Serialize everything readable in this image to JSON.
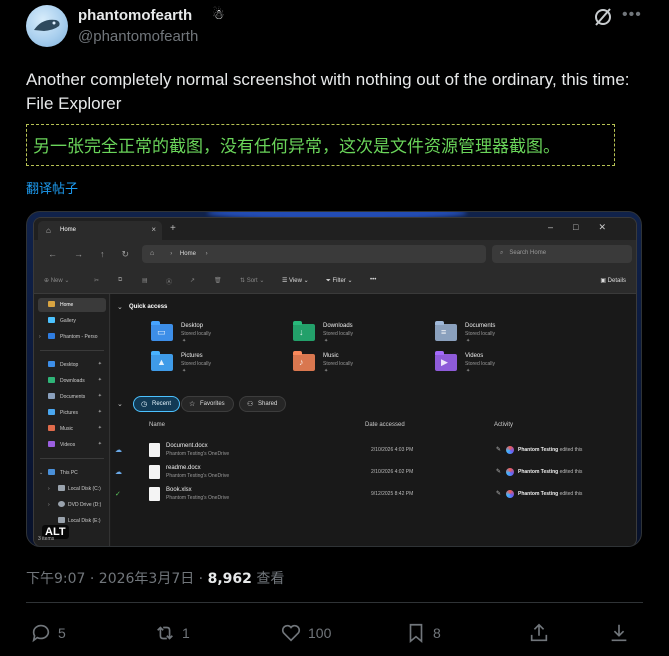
{
  "tweet": {
    "display_name": "phantomofearth",
    "badge": "☃",
    "handle": "@phantomofearth",
    "text": "Another completely normal screenshot with nothing out of the ordinary, this time: File Explorer",
    "translation": "另一张完全正常的截图，没有任何异常，这次是文件资源管理器截图。",
    "translate_link": "翻译帖子",
    "timestamp": "下午9:07 · 2026年3月7日 · ",
    "views_count": "8,962",
    "views_label": " 查看",
    "actions": {
      "replies": "5",
      "reposts": "1",
      "likes": "100",
      "bookmarks": "8"
    }
  },
  "explorer": {
    "tab_title": "Home",
    "address": "Home",
    "search_placeholder": "Search Home",
    "toolbar": {
      "new_label": "New",
      "sort_label": "Sort",
      "view_label": "View",
      "filter_label": "Filter",
      "more_label": "•••",
      "details_label": "Details"
    },
    "sidebar": {
      "top": [
        {
          "label": "Home",
          "color": "#d9a441"
        },
        {
          "label": "Gallery",
          "color": "#4cc2ff"
        },
        {
          "label": "Phantom - Perso",
          "color": "#2f7de1"
        }
      ],
      "pinned": [
        {
          "label": "Desktop",
          "color": "#3d8ee8"
        },
        {
          "label": "Downloads",
          "color": "#2fb578"
        },
        {
          "label": "Documents",
          "color": "#8aa0bd"
        },
        {
          "label": "Pictures",
          "color": "#4aa7f0"
        },
        {
          "label": "Music",
          "color": "#e06b4b"
        },
        {
          "label": "Videos",
          "color": "#9b5fe0"
        }
      ],
      "devices": [
        {
          "label": "This PC",
          "color": "#4a90d9"
        },
        {
          "label": "Local Disk (C:)",
          "color": "#9aa3ad"
        },
        {
          "label": "DVD Drive (D:)",
          "color": "#9aa3ad"
        },
        {
          "label": "Local Disk (E:)",
          "color": "#9aa3ad"
        }
      ],
      "alt_badge": "ALT",
      "status": "3 items"
    },
    "quick_access": {
      "heading": "Quick access",
      "folders": [
        {
          "name": "Desktop",
          "sub": "Stored locally",
          "color": "#3d8ee8",
          "glyph": "▭"
        },
        {
          "name": "Downloads",
          "sub": "Stored locally",
          "color": "#23a06a",
          "glyph": "↓"
        },
        {
          "name": "Documents",
          "sub": "Stored locally",
          "color": "#8aa0bd",
          "glyph": "≡"
        },
        {
          "name": "Pictures",
          "sub": "Stored locally",
          "color": "#3f9be8",
          "glyph": "▲"
        },
        {
          "name": "Music",
          "sub": "Stored locally",
          "color": "#d9774f",
          "glyph": "♪"
        },
        {
          "name": "Videos",
          "sub": "Stored locally",
          "color": "#8e5bd9",
          "glyph": "▶"
        }
      ]
    },
    "filters": {
      "recent": "Recent",
      "favorites": "Favorites",
      "shared": "Shared"
    },
    "columns": {
      "name": "Name",
      "date": "Date accessed",
      "activity": "Activity"
    },
    "files": [
      {
        "name": "Document.docx",
        "location": "Phantom Testing's OneDrive",
        "date": "2/10/2026 4:03 PM",
        "activity_user": "Phantom Testing",
        "activity_text": " edited this",
        "sync": "☁"
      },
      {
        "name": "readme.docx",
        "location": "Phantom Testing's OneDrive",
        "date": "2/10/2026 4:02 PM",
        "activity_user": "Phantom Testing",
        "activity_text": " edited this",
        "sync": "☁"
      },
      {
        "name": "Book.xlsx",
        "location": "Phantom Testing's OneDrive",
        "date": "9/12/2025 8:42 PM",
        "activity_user": "Phantom Testing",
        "activity_text": " edited this",
        "sync": "✓"
      }
    ]
  }
}
